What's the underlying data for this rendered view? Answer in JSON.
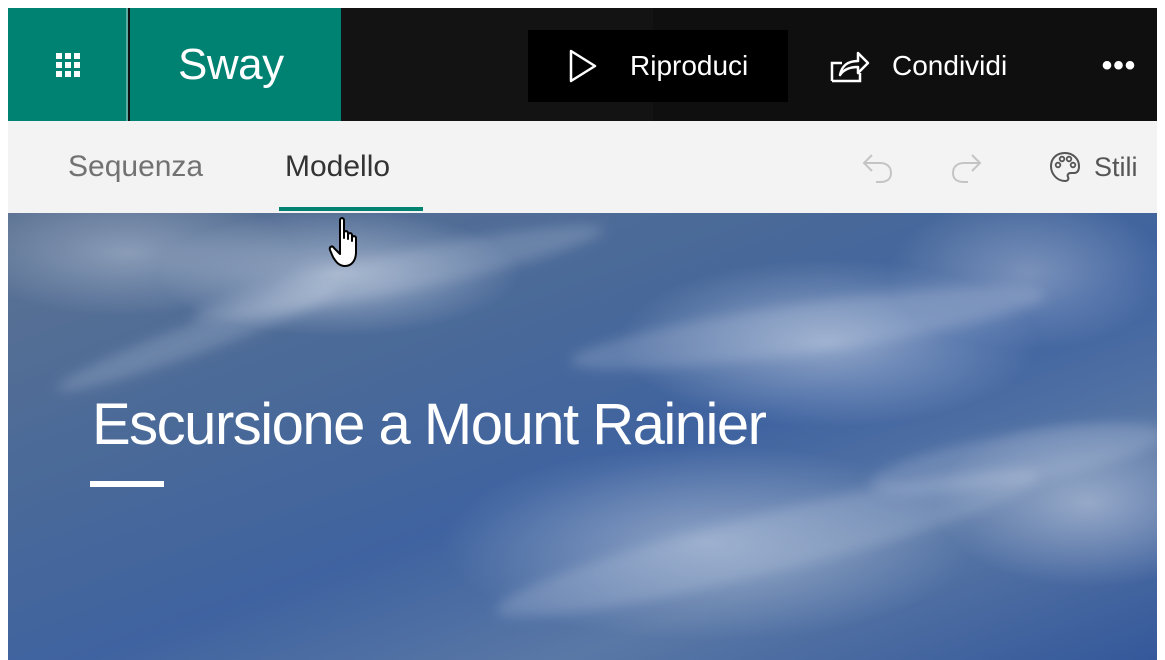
{
  "app": {
    "name": "Sway"
  },
  "topbar": {
    "apps_icon": "waffle-grid-icon",
    "play": {
      "label": "Riproduci",
      "icon": "play-icon"
    },
    "share": {
      "label": "Condividi",
      "icon": "share-icon"
    },
    "more": {
      "label": "•••",
      "icon": "more-icon"
    }
  },
  "toolbar": {
    "tabs": [
      {
        "label": "Sequenza",
        "active": false
      },
      {
        "label": "Modello",
        "active": true
      }
    ],
    "undo_icon": "undo-icon",
    "redo_icon": "redo-icon",
    "styles": {
      "label": "Stili",
      "icon": "palette-icon"
    }
  },
  "hero": {
    "title": "Escursione a Mount Rainier"
  },
  "colors": {
    "brand": "#008272",
    "topbar_bg": "#0f0f0f",
    "toolbar_bg": "#f3f3f3"
  }
}
